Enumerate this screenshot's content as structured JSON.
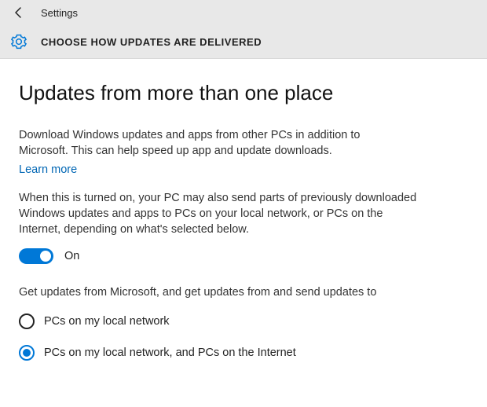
{
  "header": {
    "title": "Settings",
    "subtitle": "CHOOSE HOW UPDATES ARE DELIVERED"
  },
  "page": {
    "heading": "Updates from more than one place",
    "intro": "Download Windows updates and apps from other PCs in addition to Microsoft. This can help speed up app and update downloads.",
    "learn_more": "Learn more",
    "detail": "When this is turned on, your PC may also send parts of previously downloaded Windows updates and apps to PCs on your local network, or PCs on the Internet, depending on what's selected below.",
    "toggle_label": "On",
    "radio_prompt": "Get updates from Microsoft, and get updates from and send updates to",
    "radio_options": [
      {
        "label": "PCs on my local network",
        "selected": false
      },
      {
        "label": "PCs on my local network, and PCs on the Internet",
        "selected": true
      }
    ]
  }
}
